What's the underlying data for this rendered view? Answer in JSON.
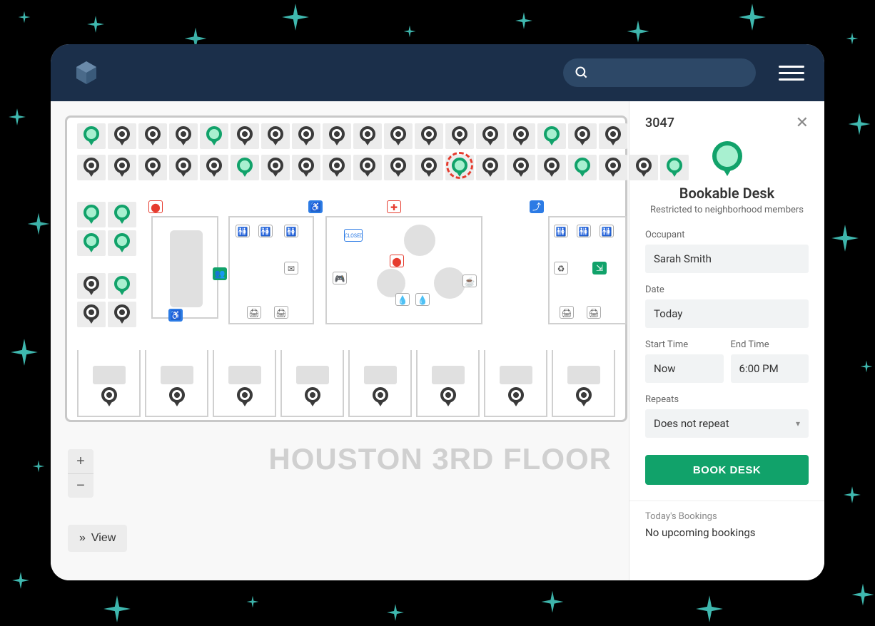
{
  "header": {
    "search_placeholder": ""
  },
  "floor": {
    "label": "HOUSTON 3RD FLOOR"
  },
  "controls": {
    "view_label": "View"
  },
  "panel": {
    "desk_id": "3047",
    "desk_type": "Bookable Desk",
    "restriction": "Restricted to neighborhood members",
    "occupant_label": "Occupant",
    "occupant_value": "Sarah Smith",
    "date_label": "Date",
    "date_value": "Today",
    "start_label": "Start Time",
    "start_value": "Now",
    "end_label": "End Time",
    "end_value": "6:00 PM",
    "repeats_label": "Repeats",
    "repeats_value": "Does not repeat",
    "book_button": "BOOK DESK",
    "bookings_title": "Today's Bookings",
    "bookings_empty": "No upcoming bookings"
  },
  "colors": {
    "accent_green": "#11a26a",
    "header_bg": "#1b2f4a",
    "sparkle": "#3fb8af",
    "selection_red": "#e63b2e"
  },
  "map": {
    "row1": [
      "green",
      "dark",
      "dark",
      "dark",
      "green",
      "dark",
      "dark",
      "dark",
      "dark",
      "dark",
      "dark",
      "dark",
      "dark",
      "dark",
      "dark",
      "green",
      "dark",
      "dark"
    ],
    "row2": [
      "dark",
      "dark",
      "dark",
      "dark",
      "dark",
      "green",
      "dark",
      "dark",
      "dark",
      "dark",
      "dark",
      "dark",
      "green-selected",
      "dark",
      "dark",
      "dark",
      "green",
      "dark",
      "dark",
      "green"
    ],
    "clusterA_row1": [
      "green",
      "green"
    ],
    "clusterA_row2": [
      "green",
      "green"
    ],
    "clusterA_row3": [
      "dark",
      "green"
    ],
    "clusterA_row4": [
      "dark",
      "dark"
    ],
    "offices": 8,
    "facility_icons": [
      "fire-extinguisher",
      "accessibility",
      "first-aid",
      "stairs-up",
      "closed-sign",
      "mail",
      "game-controller",
      "printer",
      "recycle",
      "emergency-exit",
      "coffee",
      "restroom",
      "water",
      "stairs"
    ]
  }
}
